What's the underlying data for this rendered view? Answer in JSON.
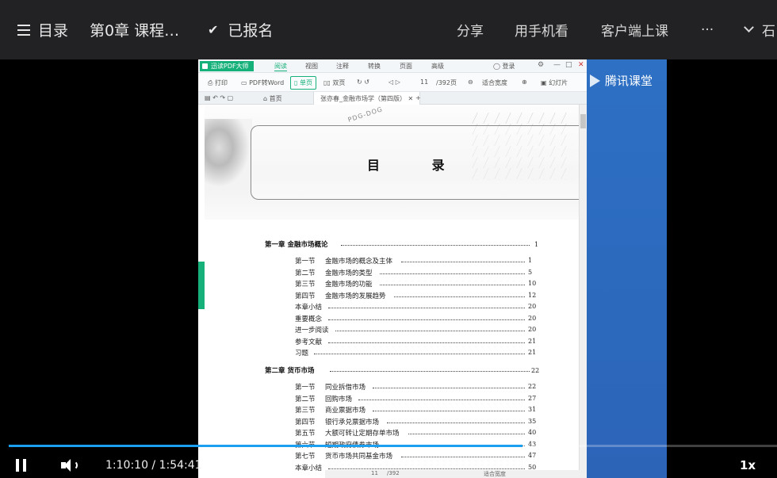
{
  "topbar": {
    "catalog_label": "目录",
    "chapter_title": "第0章  课程…",
    "enrolled_label": "已报名",
    "share_label": "分享",
    "mobile_label": "用手机看",
    "client_label": "客户端上课",
    "more_label": "···",
    "user_label": "石"
  },
  "pdf_app": {
    "app_name": "迅读PDF大师",
    "menus": [
      "阅读",
      "视图",
      "注释",
      "转换",
      "页面",
      "高级"
    ],
    "login": "登录",
    "tools": {
      "print": "打印",
      "to_word": "PDF转Word",
      "single_page": "单页",
      "double_page": "双页",
      "current_page": "11",
      "total_pages": "/392页",
      "fit_width": "适合宽度",
      "slideshow": "幻灯片"
    },
    "tabs": {
      "home": "首页",
      "document": "张亦春_金融市场学（第四版）"
    }
  },
  "page": {
    "stamp_text": "PDG-DOG",
    "title": "目  录",
    "chapter1": {
      "label": "第一章",
      "title": "金融市场概论",
      "page": "1"
    },
    "chapter1_items": [
      {
        "sec": "第一节",
        "title": "金融市场的概念及主体",
        "page": "1"
      },
      {
        "sec": "第二节",
        "title": "金融市场的类型",
        "page": "5"
      },
      {
        "sec": "第三节",
        "title": "金融市场的功能",
        "page": "10"
      },
      {
        "sec": "第四节",
        "title": "金融市场的发展趋势",
        "page": "12"
      },
      {
        "sec": "",
        "title": "本章小结",
        "page": "20"
      },
      {
        "sec": "",
        "title": "重要概念",
        "page": "20"
      },
      {
        "sec": "",
        "title": "进一步阅读",
        "page": "20"
      },
      {
        "sec": "",
        "title": "参考文献",
        "page": "21"
      },
      {
        "sec": "",
        "title": "习题",
        "page": "21"
      }
    ],
    "chapter2": {
      "label": "第二章",
      "title": "货币市场",
      "page": "22"
    },
    "chapter2_items": [
      {
        "sec": "第一节",
        "title": "同业拆借市场",
        "page": "22"
      },
      {
        "sec": "第二节",
        "title": "回购市场",
        "page": "27"
      },
      {
        "sec": "第三节",
        "title": "商业票据市场",
        "page": "31"
      },
      {
        "sec": "第四节",
        "title": "银行承兑票据市场",
        "page": "35"
      },
      {
        "sec": "第五节",
        "title": "大额可转让定期存单市场",
        "page": "40"
      },
      {
        "sec": "第六节",
        "title": "短期政府债券市场",
        "page": "43"
      },
      {
        "sec": "第七节",
        "title": "货币市场共同基金市场",
        "page": "47"
      },
      {
        "sec": "",
        "title": "本章小结",
        "page": "50"
      }
    ],
    "bottom_bar": {
      "page": "11",
      "total": "/392",
      "zoom": "适合宽度"
    }
  },
  "brand": {
    "name": "腾讯课堂"
  },
  "player": {
    "current_time": "1:10:10",
    "duration": "1:54:41",
    "time_separator": " / ",
    "progress": 0.669,
    "speed": "1x",
    "accent_color": "#1b9ff0"
  }
}
